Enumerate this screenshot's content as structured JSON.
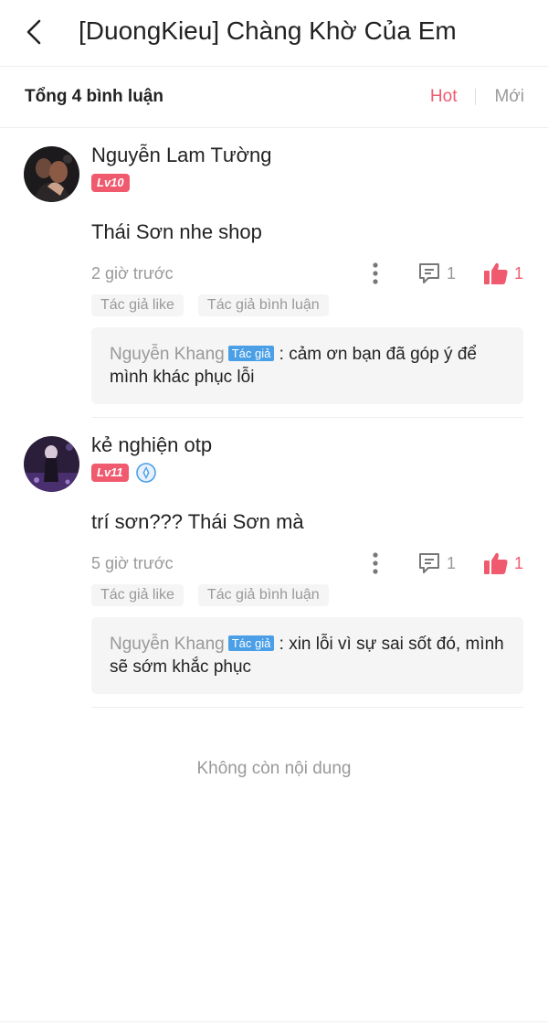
{
  "header": {
    "back_icon": "chevron-left-icon",
    "title": "[DuongKieu] Chàng Khờ Của Em"
  },
  "subbar": {
    "total": "Tổng 4 bình luận",
    "sort_hot": "Hot",
    "sort_new": "Mới",
    "accent_color": "#ef5a6f"
  },
  "comments": [
    {
      "username": "Nguyễn Lam Tường",
      "level": "Lv10",
      "content": "Thái Sơn nhe shop",
      "time": "2 giờ trước",
      "reply_count": "1",
      "like_count": "1",
      "tags": [
        "Tác giả like",
        "Tác giả bình luận"
      ],
      "reply": {
        "author": "Nguyễn Khang",
        "badge": "Tác giả",
        "text": ": cảm ơn bạn đã góp ý để mình khác phục lỗi"
      }
    },
    {
      "username": "kẻ nghiện otp",
      "level": "Lv11",
      "verified_icon": "verified-badge-icon",
      "content": "trí sơn??? Thái Sơn mà",
      "time": "5 giờ trước",
      "reply_count": "1",
      "like_count": "1",
      "tags": [
        "Tác giả like",
        "Tác giả bình luận"
      ],
      "reply": {
        "author": "Nguyễn Khang",
        "badge": "Tác giả",
        "text": ": xin lỗi vì sự sai sốt đó, mình sẽ sớm khắc phục"
      }
    }
  ],
  "footer": {
    "end_text": "Không còn nội dung"
  }
}
